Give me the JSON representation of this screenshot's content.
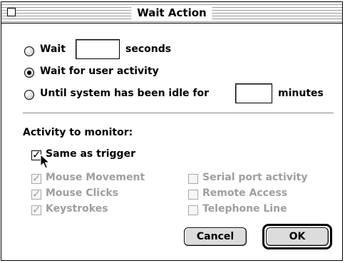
{
  "window": {
    "title": "Wait Action"
  },
  "options": {
    "wait": {
      "label": "Wait",
      "value": "",
      "unit": "seconds",
      "selected": false
    },
    "user_activity": {
      "label": "Wait for user activity",
      "selected": true
    },
    "idle": {
      "label": "Until system has been idle for",
      "value": "",
      "unit": "minutes",
      "selected": false
    }
  },
  "monitor": {
    "heading": "Activity to monitor:",
    "same_as_trigger": {
      "label": "Same as trigger",
      "checked": true
    },
    "left_items": [
      {
        "label": "Mouse Movement",
        "checked": true
      },
      {
        "label": "Mouse Clicks",
        "checked": true
      },
      {
        "label": "Keystrokes",
        "checked": true
      }
    ],
    "right_items": [
      {
        "label": "Serial port activity",
        "checked": false
      },
      {
        "label": "Remote Access",
        "checked": false
      },
      {
        "label": "Telephone Line",
        "checked": false
      }
    ]
  },
  "buttons": {
    "cancel": "Cancel",
    "ok": "OK"
  },
  "icons": {
    "checkmark": "✓"
  }
}
